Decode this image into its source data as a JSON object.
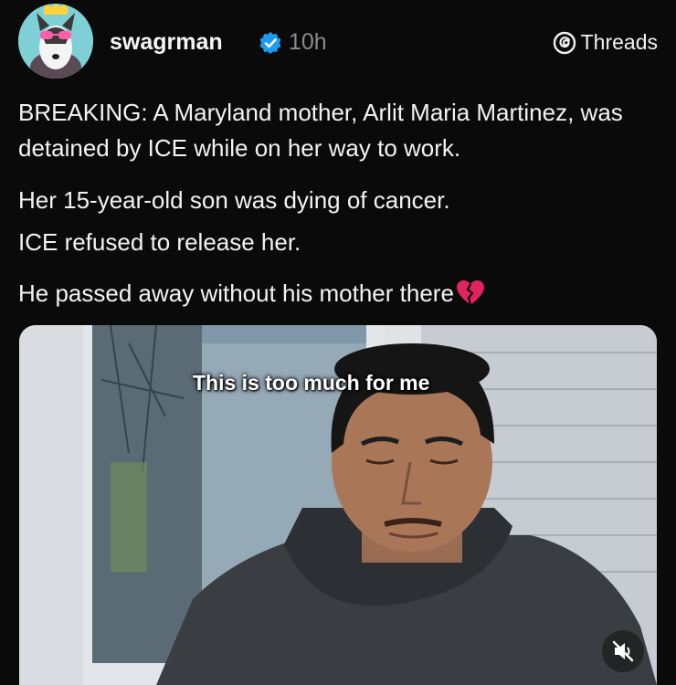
{
  "post": {
    "username": "swagrman",
    "timestamp": "10h",
    "platform_label": "Threads",
    "verified": true,
    "paragraphs": [
      "BREAKING: A Maryland mother, Arlit Maria Martinez, was detained by ICE while on her way to work.",
      "Her 15-year-old son was dying of cancer.",
      "ICE refused to release her.",
      "He passed away without his mother there"
    ],
    "emoji": "broken-heart-icon",
    "media": {
      "type": "video",
      "caption": "This is too much for me",
      "muted": true
    }
  },
  "colors": {
    "background": "#0a0a0a",
    "text": "#f3f3f3",
    "muted_text": "#8b8b8b",
    "verified": "#1d9bf0",
    "heart": "#e0245e"
  }
}
